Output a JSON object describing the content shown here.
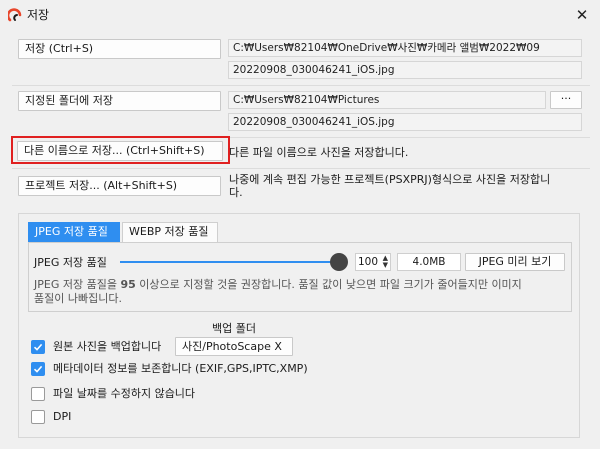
{
  "window": {
    "title": "저장"
  },
  "rows": [
    {
      "button": "저장   (Ctrl+S)",
      "path": "C:₩Users₩82104₩OneDrive₩사진₩카메라 앨범₩2022₩09",
      "file": "20220908_030046241_iOS.jpg"
    },
    {
      "button": "지정된 폴더에 저장",
      "path": "C:₩Users₩82104₩Pictures",
      "browse": "···",
      "file": "20220908_030046241_iOS.jpg"
    },
    {
      "button": "다른 이름으로 저장...   (Ctrl+Shift+S)",
      "desc": "다른 파일 이름으로 사진을 저장합니다."
    },
    {
      "button": "프로젝트 저장...   (Alt+Shift+S)",
      "desc1": "나중에 계속 편집 가능한 프로젝트(PSXPRJ)형식으로 사진을 저장합니",
      "desc2": "다."
    }
  ],
  "quality": {
    "tabs": [
      "JPEG 저장 품질",
      "WEBP 저장 품질"
    ],
    "label": "JPEG 저장 품질",
    "value": "100",
    "value_fraction": 1.0,
    "size": "4.0MB",
    "preview": "JPEG 미리 보기",
    "hint1_pre": "JPEG 저장 품질을 ",
    "hint1_bold": "95",
    "hint1_post": " 이상으로 지정할 것을 권장합니다. 품질 값이 낮으면 파일 크기가 줄어들지만 이미지",
    "hint2": "품질이 나빠집니다."
  },
  "backup": {
    "header": "백업 폴더",
    "folder": "사진/PhotoScape X"
  },
  "options": [
    {
      "label": "원본 사진을 백업합니다",
      "checked": true
    },
    {
      "label": "메타데이터 정보를 보존합니다 (EXIF,GPS,IPTC,XMP)",
      "checked": true
    },
    {
      "label": "파일 날짜를 수정하지 않습니다",
      "checked": false
    },
    {
      "label": "DPI",
      "checked": false
    }
  ],
  "colors": {
    "accent": "#2f8ef0",
    "highlight": "#e02020"
  }
}
